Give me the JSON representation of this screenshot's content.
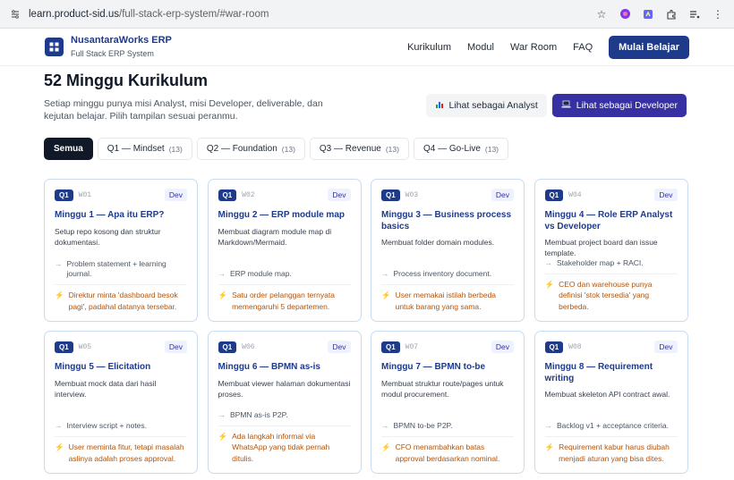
{
  "browser": {
    "url_host": "learn.product-sid.us",
    "url_path": "/full-stack-erp-system/#war-room"
  },
  "header": {
    "brand_name": "NusantaraWorks ERP",
    "brand_sub": "Full Stack ERP System",
    "nav": [
      "Kurikulum",
      "Modul",
      "War Room",
      "FAQ"
    ],
    "cta": "Mulai Belajar"
  },
  "hero": {
    "title": "52 Minggu Kurikulum",
    "description": "Setiap minggu punya misi Analyst, misi Developer, deliverable, dan kejutan belajar. Pilih tampilan sesuai peranmu.",
    "analyst_btn": "Lihat sebagai Analyst",
    "developer_btn": "Lihat sebagai Developer"
  },
  "filters": [
    {
      "label": "Semua",
      "count": ""
    },
    {
      "label": "Q1 — Mindset",
      "count": "(13)"
    },
    {
      "label": "Q2 — Foundation",
      "count": "(13)"
    },
    {
      "label": "Q3 — Revenue",
      "count": "(13)"
    },
    {
      "label": "Q4 — Go-Live",
      "count": "(13)"
    }
  ],
  "cards": [
    {
      "q": "Q1",
      "week": "W01",
      "role": "Dev",
      "title": "Minggu 1 — Apa itu ERP?",
      "desc": "Setup repo kosong dan struktur dokumentasi.",
      "deliverable": "Problem statement + learning journal.",
      "risk": "Direktur minta 'dashboard besok pagi', padahal datanya tersebar."
    },
    {
      "q": "Q1",
      "week": "W02",
      "role": "Dev",
      "title": "Minggu 2 — ERP module map",
      "desc": "Membuat diagram module map di Markdown/Mermaid.",
      "deliverable": "ERP module map.",
      "risk": "Satu order pelanggan ternyata memengaruhi 5 departemen."
    },
    {
      "q": "Q1",
      "week": "W03",
      "role": "Dev",
      "title": "Minggu 3 — Business process basics",
      "desc": "Membuat folder domain modules.",
      "deliverable": "Process inventory document.",
      "risk": "User memakai istilah berbeda untuk barang yang sama."
    },
    {
      "q": "Q1",
      "week": "W04",
      "role": "Dev",
      "title": "Minggu 4 — Role ERP Analyst vs Developer",
      "desc": "Membuat project board dan issue template.",
      "deliverable": "Stakeholder map + RACI.",
      "risk": "CEO dan warehouse punya definisi 'stok tersedia' yang berbeda."
    },
    {
      "q": "Q1",
      "week": "W05",
      "role": "Dev",
      "title": "Minggu 5 — Elicitation",
      "desc": "Membuat mock data dari hasil interview.",
      "deliverable": "Interview script + notes.",
      "risk": "User meminta fitur, tetapi masalah aslinya adalah proses approval."
    },
    {
      "q": "Q1",
      "week": "W06",
      "role": "Dev",
      "title": "Minggu 6 — BPMN as-is",
      "desc": "Membuat viewer halaman dokumentasi proses.",
      "deliverable": "BPMN as-is P2P.",
      "risk": "Ada langkah informal via WhatsApp yang tidak pernah ditulis."
    },
    {
      "q": "Q1",
      "week": "W07",
      "role": "Dev",
      "title": "Minggu 7 — BPMN to-be",
      "desc": "Membuat struktur route/pages untuk modul procurement.",
      "deliverable": "BPMN to-be P2P.",
      "risk": "CFO menambahkan batas approval berdasarkan nominal."
    },
    {
      "q": "Q1",
      "week": "W08",
      "role": "Dev",
      "title": "Minggu 8 — Requirement writing",
      "desc": "Membuat skeleton API contract awal.",
      "deliverable": "Backlog v1 + acceptance criteria.",
      "risk": "Requirement kabur harus diubah menjadi aturan yang bisa dites."
    }
  ]
}
